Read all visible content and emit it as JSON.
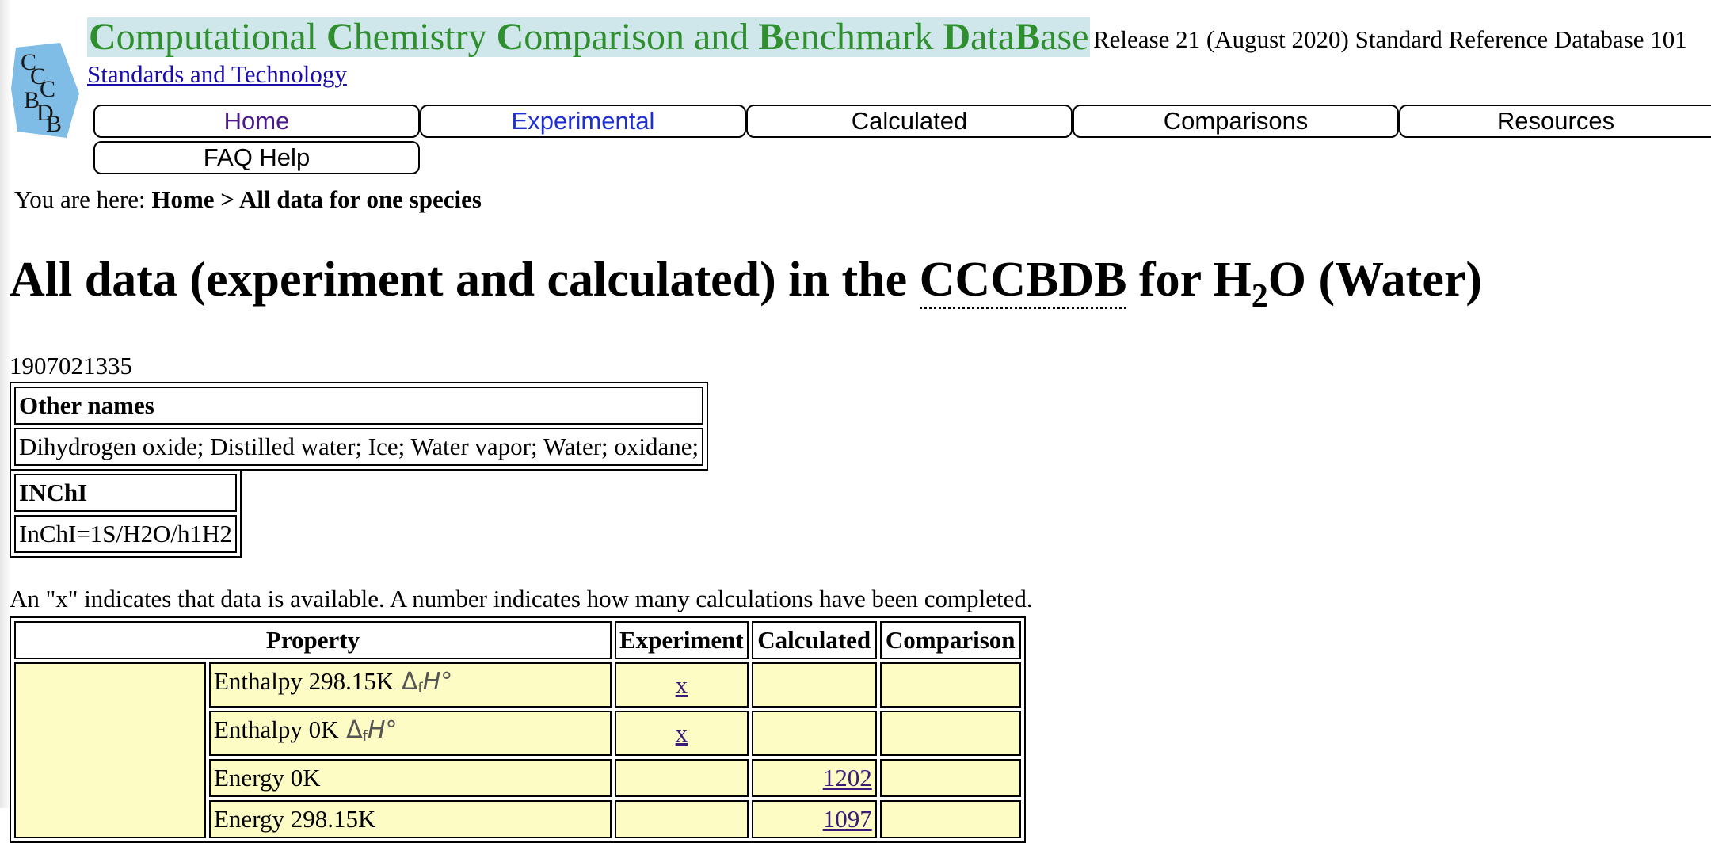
{
  "header": {
    "title_parts": [
      {
        "cap": "C",
        "rest": "omputational "
      },
      {
        "cap": "C",
        "rest": "hemistry "
      },
      {
        "cap": "C",
        "rest": "omparison and "
      },
      {
        "cap": "B",
        "rest": "enchmark "
      },
      {
        "cap": "D",
        "rest": "ata"
      },
      {
        "cap": "B",
        "rest": "ase"
      }
    ],
    "release": "Release 21 (August 2020) Standard Reference Database 101",
    "link": "Standards and Technology",
    "logo_letters": "CCCBDB"
  },
  "nav": {
    "home": "Home",
    "experimental": "Experimental",
    "calculated": "Calculated",
    "comparisons": "Comparisons",
    "resources": "Resources",
    "faq": "FAQ Help"
  },
  "breadcrumb": {
    "prefix": "You are here:",
    "path": "Home > All data for one species"
  },
  "heading": {
    "before": "All data (experiment and calculated) in the ",
    "abbr": "CCCBDB",
    "middle": " for H",
    "subscript": "2",
    "after": "O (Water)"
  },
  "code_number": "1907021335",
  "other_names": {
    "header": "Other names",
    "value": "Dihydrogen oxide; Distilled water; Ice; Water vapor; Water; oxidane;"
  },
  "inchi": {
    "header": "INChI",
    "value": "InChI=1S/H2O/h1H2"
  },
  "note": "An \"x\" indicates that data is available. A number indicates how many calculations have been completed.",
  "table": {
    "headers": {
      "property": "Property",
      "experiment": "Experiment",
      "calculated": "Calculated",
      "comparison": "Comparison"
    },
    "rows": [
      {
        "name": "Enthalpy 298.15K",
        "symbol": true,
        "experiment": "x",
        "calculated": "",
        "comparison": ""
      },
      {
        "name": "Enthalpy 0K",
        "symbol": true,
        "experiment": "x",
        "calculated": "",
        "comparison": ""
      },
      {
        "name": "Energy 0K",
        "symbol": false,
        "experiment": "",
        "calculated": "1202",
        "comparison": ""
      },
      {
        "name": "Energy 298.15K",
        "symbol": false,
        "experiment": "",
        "calculated": "1097",
        "comparison": ""
      }
    ]
  }
}
